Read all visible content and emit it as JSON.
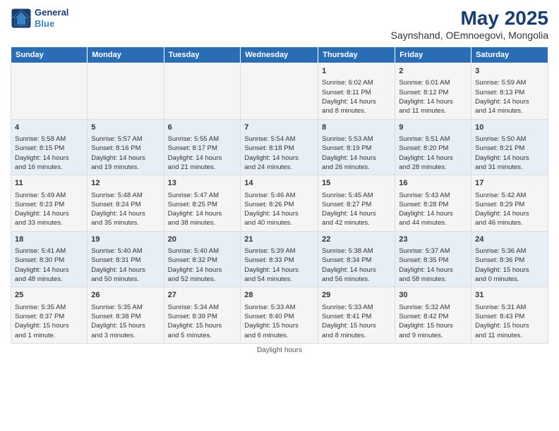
{
  "logo": {
    "line1": "General",
    "line2": "Blue"
  },
  "title": "May 2025",
  "subtitle": "Saynshand, OEmnoegovi, Mongolia",
  "days_of_week": [
    "Sunday",
    "Monday",
    "Tuesday",
    "Wednesday",
    "Thursday",
    "Friday",
    "Saturday"
  ],
  "footer": "Daylight hours",
  "weeks": [
    [
      {
        "day": "",
        "content": ""
      },
      {
        "day": "",
        "content": ""
      },
      {
        "day": "",
        "content": ""
      },
      {
        "day": "",
        "content": ""
      },
      {
        "day": "1",
        "content": "Sunrise: 6:02 AM\nSunset: 8:11 PM\nDaylight: 14 hours\nand 8 minutes."
      },
      {
        "day": "2",
        "content": "Sunrise: 6:01 AM\nSunset: 8:12 PM\nDaylight: 14 hours\nand 11 minutes."
      },
      {
        "day": "3",
        "content": "Sunrise: 5:59 AM\nSunset: 8:13 PM\nDaylight: 14 hours\nand 14 minutes."
      }
    ],
    [
      {
        "day": "4",
        "content": "Sunrise: 5:58 AM\nSunset: 8:15 PM\nDaylight: 14 hours\nand 16 minutes."
      },
      {
        "day": "5",
        "content": "Sunrise: 5:57 AM\nSunset: 8:16 PM\nDaylight: 14 hours\nand 19 minutes."
      },
      {
        "day": "6",
        "content": "Sunrise: 5:55 AM\nSunset: 8:17 PM\nDaylight: 14 hours\nand 21 minutes."
      },
      {
        "day": "7",
        "content": "Sunrise: 5:54 AM\nSunset: 8:18 PM\nDaylight: 14 hours\nand 24 minutes."
      },
      {
        "day": "8",
        "content": "Sunrise: 5:53 AM\nSunset: 8:19 PM\nDaylight: 14 hours\nand 26 minutes."
      },
      {
        "day": "9",
        "content": "Sunrise: 5:51 AM\nSunset: 8:20 PM\nDaylight: 14 hours\nand 28 minutes."
      },
      {
        "day": "10",
        "content": "Sunrise: 5:50 AM\nSunset: 8:21 PM\nDaylight: 14 hours\nand 31 minutes."
      }
    ],
    [
      {
        "day": "11",
        "content": "Sunrise: 5:49 AM\nSunset: 8:23 PM\nDaylight: 14 hours\nand 33 minutes."
      },
      {
        "day": "12",
        "content": "Sunrise: 5:48 AM\nSunset: 8:24 PM\nDaylight: 14 hours\nand 35 minutes."
      },
      {
        "day": "13",
        "content": "Sunrise: 5:47 AM\nSunset: 8:25 PM\nDaylight: 14 hours\nand 38 minutes."
      },
      {
        "day": "14",
        "content": "Sunrise: 5:46 AM\nSunset: 8:26 PM\nDaylight: 14 hours\nand 40 minutes."
      },
      {
        "day": "15",
        "content": "Sunrise: 5:45 AM\nSunset: 8:27 PM\nDaylight: 14 hours\nand 42 minutes."
      },
      {
        "day": "16",
        "content": "Sunrise: 5:43 AM\nSunset: 8:28 PM\nDaylight: 14 hours\nand 44 minutes."
      },
      {
        "day": "17",
        "content": "Sunrise: 5:42 AM\nSunset: 8:29 PM\nDaylight: 14 hours\nand 46 minutes."
      }
    ],
    [
      {
        "day": "18",
        "content": "Sunrise: 5:41 AM\nSunset: 8:30 PM\nDaylight: 14 hours\nand 48 minutes."
      },
      {
        "day": "19",
        "content": "Sunrise: 5:40 AM\nSunset: 8:31 PM\nDaylight: 14 hours\nand 50 minutes."
      },
      {
        "day": "20",
        "content": "Sunrise: 5:40 AM\nSunset: 8:32 PM\nDaylight: 14 hours\nand 52 minutes."
      },
      {
        "day": "21",
        "content": "Sunrise: 5:39 AM\nSunset: 8:33 PM\nDaylight: 14 hours\nand 54 minutes."
      },
      {
        "day": "22",
        "content": "Sunrise: 5:38 AM\nSunset: 8:34 PM\nDaylight: 14 hours\nand 56 minutes."
      },
      {
        "day": "23",
        "content": "Sunrise: 5:37 AM\nSunset: 8:35 PM\nDaylight: 14 hours\nand 58 minutes."
      },
      {
        "day": "24",
        "content": "Sunrise: 5:36 AM\nSunset: 8:36 PM\nDaylight: 15 hours\nand 0 minutes."
      }
    ],
    [
      {
        "day": "25",
        "content": "Sunrise: 5:35 AM\nSunset: 8:37 PM\nDaylight: 15 hours\nand 1 minute."
      },
      {
        "day": "26",
        "content": "Sunrise: 5:35 AM\nSunset: 8:38 PM\nDaylight: 15 hours\nand 3 minutes."
      },
      {
        "day": "27",
        "content": "Sunrise: 5:34 AM\nSunset: 8:39 PM\nDaylight: 15 hours\nand 5 minutes."
      },
      {
        "day": "28",
        "content": "Sunrise: 5:33 AM\nSunset: 8:40 PM\nDaylight: 15 hours\nand 6 minutes."
      },
      {
        "day": "29",
        "content": "Sunrise: 5:33 AM\nSunset: 8:41 PM\nDaylight: 15 hours\nand 8 minutes."
      },
      {
        "day": "30",
        "content": "Sunrise: 5:32 AM\nSunset: 8:42 PM\nDaylight: 15 hours\nand 9 minutes."
      },
      {
        "day": "31",
        "content": "Sunrise: 5:31 AM\nSunset: 8:43 PM\nDaylight: 15 hours\nand 11 minutes."
      }
    ]
  ]
}
